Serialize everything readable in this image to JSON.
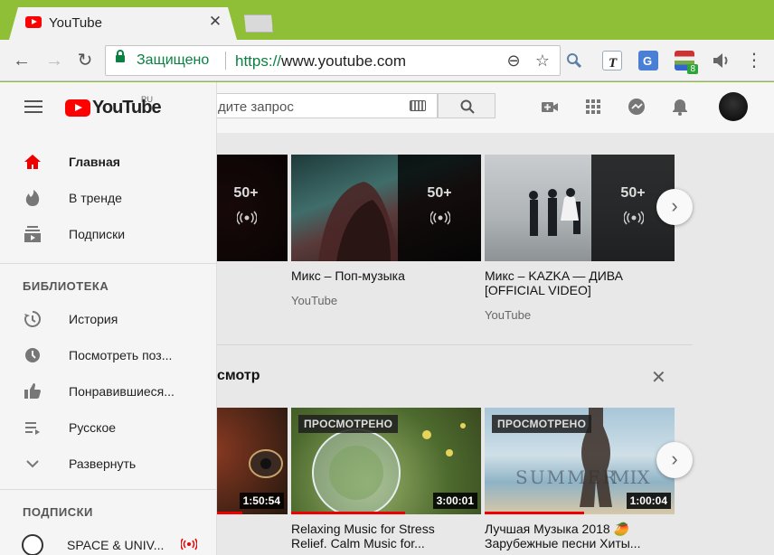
{
  "browser": {
    "tab_title": "YouTube",
    "tab_close": "✕",
    "secure_label": "Защищено",
    "url_scheme": "https://",
    "url_host": "www.youtube.com",
    "extension_badge": "8",
    "nav_glyphs": {
      "back": "←",
      "forward": "→",
      "reload": "↻",
      "menu": "⋮",
      "zoom": "⊖",
      "star": "☆"
    }
  },
  "header": {
    "search_placeholder": "Введите запрос",
    "search_placeholder_visible": "дите запрос"
  },
  "logo": {
    "text": "YouTube",
    "region": "RU"
  },
  "guide": {
    "main_items": [
      {
        "label": "Главная",
        "icon": "home-icon",
        "active": true
      },
      {
        "label": "В тренде",
        "icon": "flame-icon"
      },
      {
        "label": "Подписки",
        "icon": "subscriptions-icon"
      }
    ],
    "library_heading": "БИБЛИОТЕКА",
    "library_items": [
      {
        "label": "История",
        "icon": "history-icon"
      },
      {
        "label": "Посмотреть поз...",
        "icon": "clock-icon"
      },
      {
        "label": "Понравившиеся...",
        "icon": "thumbs-up-icon"
      },
      {
        "label": "Русское",
        "icon": "playlist-icon"
      },
      {
        "label": "Развернуть",
        "icon": "chevron-down-icon"
      }
    ],
    "subs_heading": "ПОДПИСКИ",
    "subs_items": [
      {
        "label": "SPACE & UNIV...",
        "icon": "channel-avatar",
        "live": true
      }
    ]
  },
  "mixes": [
    {
      "count": "50+",
      "title": "",
      "channel": ""
    },
    {
      "count": "50+",
      "title": "Микс – Поп-музыка",
      "channel": "YouTube"
    },
    {
      "count": "50+",
      "title": "Микс – KAZKA — ДИВА [OFFICIAL VIDEO]",
      "channel": "YouTube"
    }
  ],
  "section": {
    "title_visible": "смотр",
    "close": "✕"
  },
  "watched_label": "ПРОСМОТРЕНО",
  "history_videos": [
    {
      "duration": "1:50:54",
      "progress": 0.15,
      "watched": false,
      "title": ""
    },
    {
      "duration": "3:00:01",
      "progress": 0.6,
      "watched": true,
      "title": "Relaxing Music for Stress Relief. Calm Music for..."
    },
    {
      "duration": "1:00:04",
      "progress": 0.55,
      "watched": true,
      "title": "Лучшая Музыка 2018 🥭 Зарубежные песни Хиты..."
    }
  ],
  "carousel_arrow": "›"
}
